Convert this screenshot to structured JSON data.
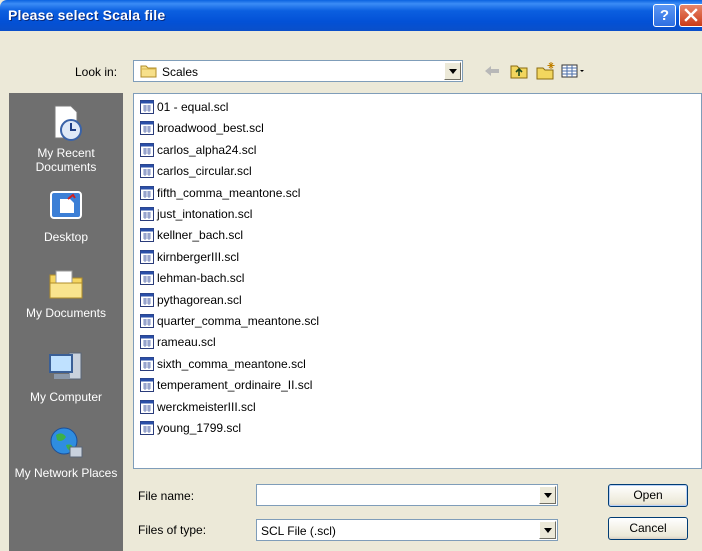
{
  "window": {
    "title": "Please select Scala file",
    "help_label": "?"
  },
  "lookin": {
    "label": "Look in:",
    "value": "Scales"
  },
  "toolbar": {
    "icons": [
      "back-arrow-icon",
      "up-folder-icon",
      "new-folder-icon",
      "view-menu-icon"
    ]
  },
  "places": [
    {
      "label": "My Recent Documents",
      "icon": "recent-documents-icon"
    },
    {
      "label": "Desktop",
      "icon": "desktop-icon"
    },
    {
      "label": "My Documents",
      "icon": "my-documents-icon"
    },
    {
      "label": "My Computer",
      "icon": "my-computer-icon"
    },
    {
      "label": "My Network Places",
      "icon": "network-places-icon"
    }
  ],
  "files": [
    "01 - equal.scl",
    "broadwood_best.scl",
    "carlos_alpha24.scl",
    "carlos_circular.scl",
    "fifth_comma_meantone.scl",
    "just_intonation.scl",
    "kellner_bach.scl",
    "kirnbergerIII.scl",
    "lehman-bach.scl",
    "pythagorean.scl",
    "quarter_comma_meantone.scl",
    "rameau.scl",
    "sixth_comma_meantone.scl",
    "temperament_ordinaire_II.scl",
    "werckmeisterIII.scl",
    "young_1799.scl"
  ],
  "filename": {
    "label": "File name:",
    "value": ""
  },
  "filetype": {
    "label": "Files of type:",
    "value": "SCL File (.scl)"
  },
  "buttons": {
    "open": "Open",
    "cancel": "Cancel"
  },
  "colors": {
    "titlebar": "#0351d6",
    "dialog_bg": "#ece9d8",
    "places_bg": "#6f6f6f",
    "field_border": "#7f9db9"
  }
}
